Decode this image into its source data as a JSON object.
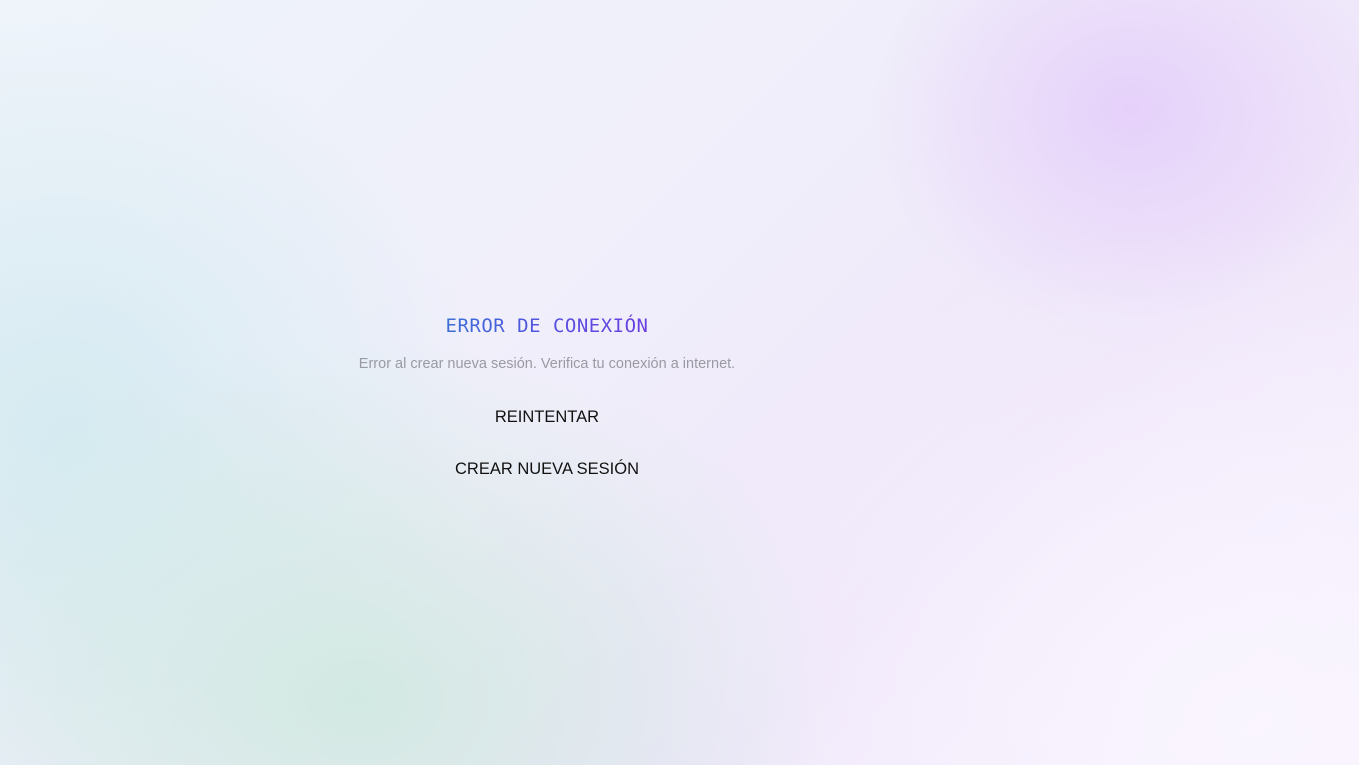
{
  "error": {
    "title": "ERROR DE CONEXIÓN",
    "message": "Error al crear nueva sesión. Verifica tu conexión a internet."
  },
  "actions": {
    "retry_label": "REINTENTAR",
    "new_session_label": "CREAR NUEVA SESIÓN"
  },
  "colors": {
    "title_gradient_start": "#3b6fd6",
    "title_gradient_end": "#6b3fe0",
    "message_text": "#9a9aa3",
    "button_text": "#111111"
  }
}
